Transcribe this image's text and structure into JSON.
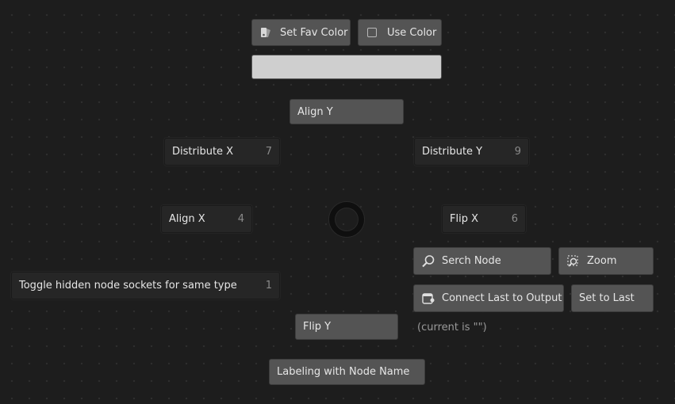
{
  "pie_menu": {
    "set_fav_color": {
      "label": "Set Fav Color",
      "icon": "eyedropper-palette-icon"
    },
    "use_color": {
      "label": "Use Color",
      "checked": false
    },
    "fav_color": {
      "color": "#cfcfcf"
    },
    "align_y": {
      "label": "Align Y"
    },
    "distribute_x": {
      "label": "Distribute X",
      "shortcut": "7"
    },
    "distribute_y": {
      "label": "Distribute Y",
      "shortcut": "9"
    },
    "align_x": {
      "label": "Align X",
      "shortcut": "4"
    },
    "flip_x": {
      "label": "Flip X",
      "shortcut": "6"
    },
    "search_node": {
      "label": "Serch Node",
      "icon": "search-icon"
    },
    "zoom": {
      "label": "Zoom",
      "icon": "zoom-selection-icon"
    },
    "toggle_hidden": {
      "label": "Toggle hidden node sockets for same type",
      "shortcut": "1"
    },
    "connect_last": {
      "label": "Connect Last to Output",
      "icon": "node-output-icon"
    },
    "set_to_last": {
      "label": "Set to Last"
    },
    "current_status": {
      "text": "(current is \"\")"
    },
    "flip_y": {
      "label": "Flip Y"
    },
    "labeling": {
      "label": "Labeling with Node Name"
    }
  }
}
